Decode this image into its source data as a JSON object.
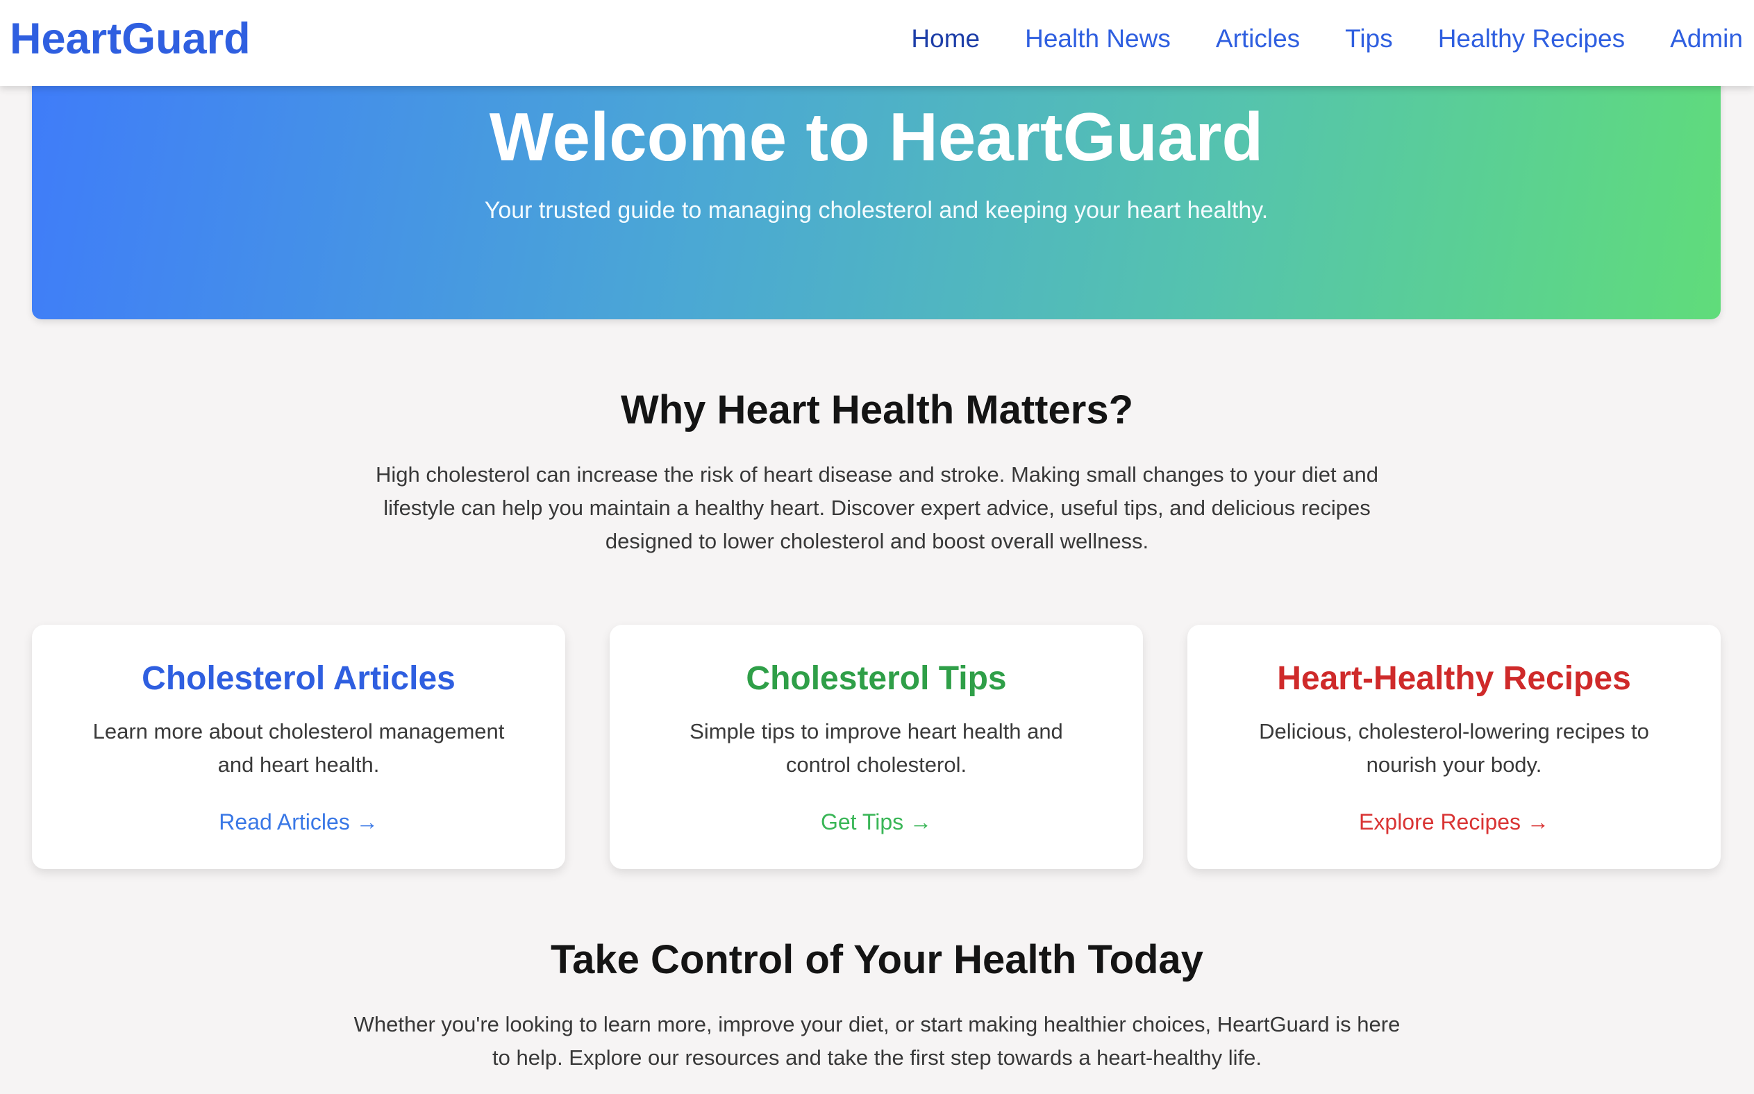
{
  "navbar": {
    "brand": "HeartGuard",
    "links": [
      {
        "label": "Home"
      },
      {
        "label": "Health News"
      },
      {
        "label": "Articles"
      },
      {
        "label": "Tips"
      },
      {
        "label": "Healthy Recipes"
      },
      {
        "label": "Admin"
      }
    ]
  },
  "hero": {
    "title": "Welcome to HeartGuard",
    "subtitle": "Your trusted guide to managing cholesterol and keeping your heart healthy."
  },
  "why": {
    "heading": "Why Heart Health Matters?",
    "body": "High cholesterol can increase the risk of heart disease and stroke. Making small changes to your diet and lifestyle can help you maintain a healthy heart. Discover expert advice, useful tips, and delicious recipes designed to lower cholesterol and boost overall wellness."
  },
  "cards": [
    {
      "title": "Cholesterol Articles",
      "description": "Learn more about cholesterol management and heart health.",
      "link": "Read Articles →"
    },
    {
      "title": "Cholesterol Tips",
      "description": "Simple tips to improve heart health and control cholesterol.",
      "link": "Get Tips →"
    },
    {
      "title": "Heart-Healthy Recipes",
      "description": "Delicious, cholesterol-lowering recipes to nourish your body.",
      "link": "Explore Recipes →"
    }
  ],
  "cta": {
    "heading": "Take Control of Your Health Today",
    "body": "Whether you're looking to learn more, improve your diet, or start making healthier choices, HeartGuard is here to help. Explore our resources and take the first step towards a heart-healthy life."
  },
  "colors": {
    "brand_blue": "#2f5fe0",
    "tips_green": "#2f9f48",
    "recipes_red": "#cf2a2a",
    "hero_gradient_start": "#3f7cf9",
    "hero_gradient_end": "#60dc7a",
    "page_background": "#f6f4f4"
  }
}
